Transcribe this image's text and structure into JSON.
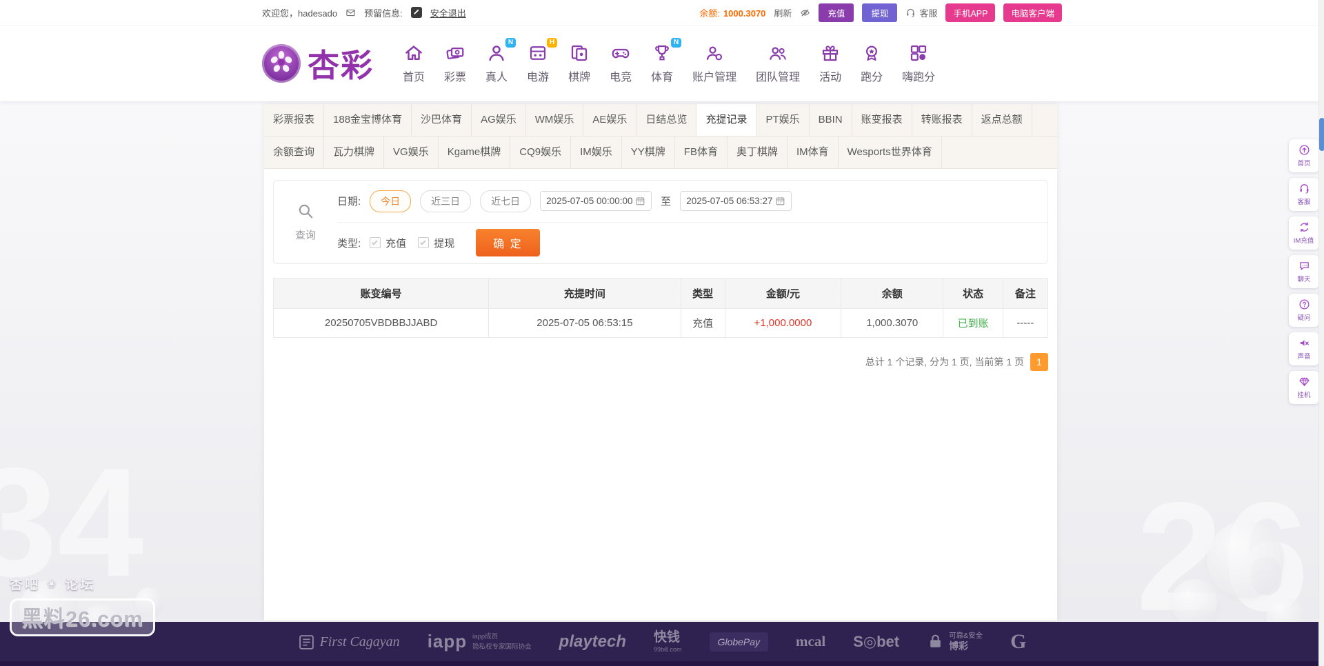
{
  "colors": {
    "accent_purple": "#8a3cad",
    "accent_indigo": "#7263d2",
    "accent_pink": "#e63a8e",
    "accent_orange": "#f4711f",
    "balance_orange": "#fe6a00",
    "amount_red": "#df3325",
    "status_green": "#43b04a",
    "footer_purple": "#2f2150"
  },
  "topbar": {
    "welcome": "欢迎您，hadesado",
    "reserved_label": "预留信息:",
    "logout": "安全退出",
    "balance_label": "余额:",
    "balance_value": "1000.3070",
    "refresh": "刷新",
    "deposit_btn": "充值",
    "withdraw_btn": "提现",
    "service": "客服",
    "mobile_app_btn": "手机APP",
    "pc_client_btn": "电脑客户端"
  },
  "nav": {
    "brand": "杏彩",
    "items": [
      {
        "label": "首页",
        "icon": "home-icon",
        "badge": ""
      },
      {
        "label": "彩票",
        "icon": "lottery-icon",
        "badge": ""
      },
      {
        "label": "真人",
        "icon": "live-icon",
        "badge": "N"
      },
      {
        "label": "电游",
        "icon": "egame-icon",
        "badge": "H"
      },
      {
        "label": "棋牌",
        "icon": "chess-icon",
        "badge": ""
      },
      {
        "label": "电竞",
        "icon": "esports-icon",
        "badge": ""
      },
      {
        "label": "体育",
        "icon": "sports-icon",
        "badge": "N"
      },
      {
        "label": "账户管理",
        "icon": "account-icon",
        "badge": ""
      },
      {
        "label": "团队管理",
        "icon": "team-icon",
        "badge": ""
      },
      {
        "label": "活动",
        "icon": "activity-icon",
        "badge": ""
      },
      {
        "label": "跑分",
        "icon": "paofen-icon",
        "badge": ""
      },
      {
        "label": "嗨跑分",
        "icon": "hipaofen-icon",
        "badge": ""
      }
    ]
  },
  "tabs": {
    "row1": [
      {
        "label": "彩票报表"
      },
      {
        "label": "188金宝博体育"
      },
      {
        "label": "沙巴体育"
      },
      {
        "label": "AG娱乐"
      },
      {
        "label": "WM娱乐"
      },
      {
        "label": "AE娱乐"
      },
      {
        "label": "日结总览"
      },
      {
        "label": "充提记录",
        "active": true
      },
      {
        "label": "PT娱乐"
      },
      {
        "label": "BBIN"
      },
      {
        "label": "账变报表"
      },
      {
        "label": "转账报表"
      },
      {
        "label": "返点总额"
      }
    ],
    "row2": [
      {
        "label": "余额查询"
      },
      {
        "label": "瓦力棋牌"
      },
      {
        "label": "VG娱乐"
      },
      {
        "label": "Kgame棋牌"
      },
      {
        "label": "CQ9娱乐"
      },
      {
        "label": "IM娱乐"
      },
      {
        "label": "YY棋牌"
      },
      {
        "label": "FB体育"
      },
      {
        "label": "奥丁棋牌"
      },
      {
        "label": "IM体育"
      },
      {
        "label": "Wesports世界体育"
      }
    ]
  },
  "query": {
    "search_label": "查询",
    "date_label": "日期:",
    "presets": [
      {
        "label": "今日",
        "active": true
      },
      {
        "label": "近三日"
      },
      {
        "label": "近七日"
      }
    ],
    "date_from": "2025-07-05 00:00:00",
    "to_label": "至",
    "date_to": "2025-07-05 06:53:27",
    "type_label": "类型:",
    "types": [
      {
        "label": "充值",
        "checked": true
      },
      {
        "label": "提现",
        "checked": true
      }
    ],
    "confirm_btn": "确 定"
  },
  "table": {
    "headers": [
      "账变编号",
      "充提时间",
      "类型",
      "金额/元",
      "余额",
      "状态",
      "备注"
    ],
    "rows": [
      {
        "id": "20250705VBDBBJJABD",
        "time": "2025-07-05 06:53:15",
        "type": "充值",
        "amount": "+1,000.0000",
        "balance": "1,000.3070",
        "status": "已到账",
        "note": "-----"
      }
    ]
  },
  "pagination": {
    "summary": "总计 1 个记录, 分为 1 页, 当前第 1 页",
    "current_page": "1"
  },
  "sidebar": {
    "items": [
      {
        "label": "首页",
        "icon": "top-icon"
      },
      {
        "label": "客服",
        "icon": "headset-icon"
      },
      {
        "label": "IM充值",
        "icon": "recharge-icon"
      },
      {
        "label": "聊天",
        "icon": "chat-icon"
      },
      {
        "label": "疑问",
        "icon": "question-icon"
      },
      {
        "label": "声音",
        "icon": "mute-icon"
      },
      {
        "label": "挂机",
        "icon": "gem-icon"
      }
    ]
  },
  "footer": {
    "logos": [
      {
        "name": "first-cagayan",
        "icon": "seal-icon",
        "main": "First Cagayan",
        "sub": "",
        "sub2": ""
      },
      {
        "name": "iapp",
        "icon": "",
        "main": "iapp",
        "sub": "iapp成员",
        "sub2": "隐私权专家国际协会"
      },
      {
        "name": "playtech",
        "icon": "",
        "main": "playtech",
        "sub": "",
        "sub2": ""
      },
      {
        "name": "99bill",
        "icon": "",
        "main": "快钱",
        "sub": "99bill.com",
        "sub2": ""
      },
      {
        "name": "globepay",
        "icon": "",
        "main": "GlobePay",
        "sub": "",
        "sub2": ""
      },
      {
        "name": "mcal",
        "icon": "",
        "main": "mcal",
        "sub": "",
        "sub2": ""
      },
      {
        "name": "sbet",
        "icon": "",
        "main": "S◎bet",
        "sub": "",
        "sub2": ""
      },
      {
        "name": "secure",
        "icon": "lock-icon",
        "main": "可靠&安全",
        "sub": "博彩",
        "sub2": ""
      },
      {
        "name": "gamcare",
        "icon": "",
        "main": "G",
        "sub": "",
        "sub2": ""
      }
    ]
  },
  "watermark": {
    "left": "杏吧",
    "ornament": "❀",
    "right": "论坛",
    "site": "黑料26.com"
  },
  "background": {
    "left_number": "34",
    "right_number": "26"
  }
}
